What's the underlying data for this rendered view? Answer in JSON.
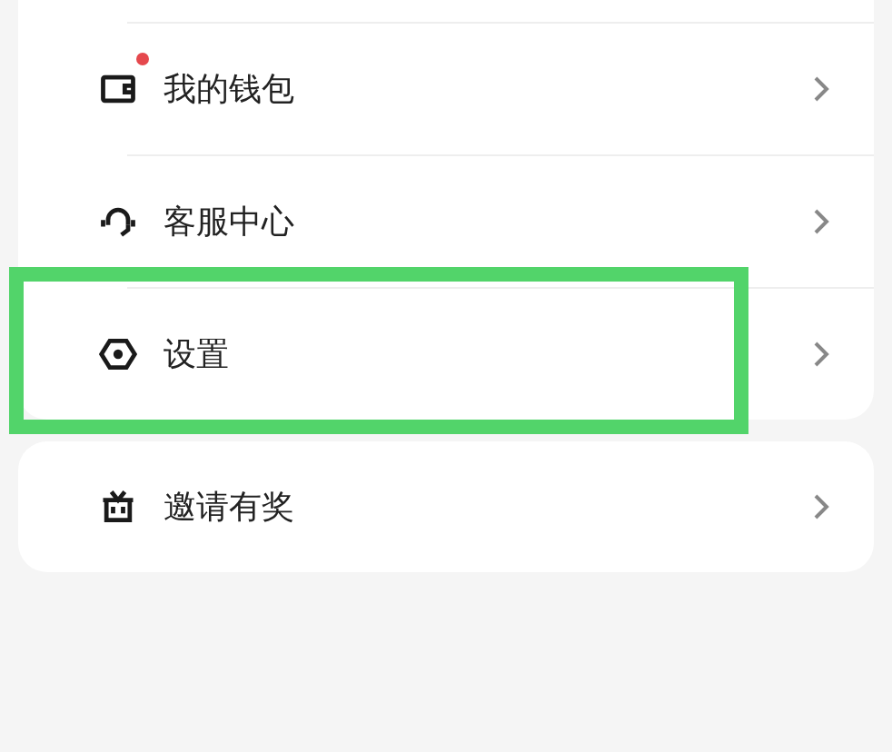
{
  "menu_groups": [
    {
      "items": [
        {
          "kind": "wallet",
          "label": "我的钱包",
          "badge_dot": true,
          "highlighted": false
        },
        {
          "kind": "service",
          "label": "客服中心",
          "badge_dot": false,
          "highlighted": false
        },
        {
          "kind": "settings",
          "label": "设置",
          "badge_dot": false,
          "highlighted": true
        }
      ]
    },
    {
      "items": [
        {
          "kind": "gift",
          "label": "邀请有奖",
          "badge_dot": false,
          "highlighted": false
        }
      ]
    }
  ]
}
